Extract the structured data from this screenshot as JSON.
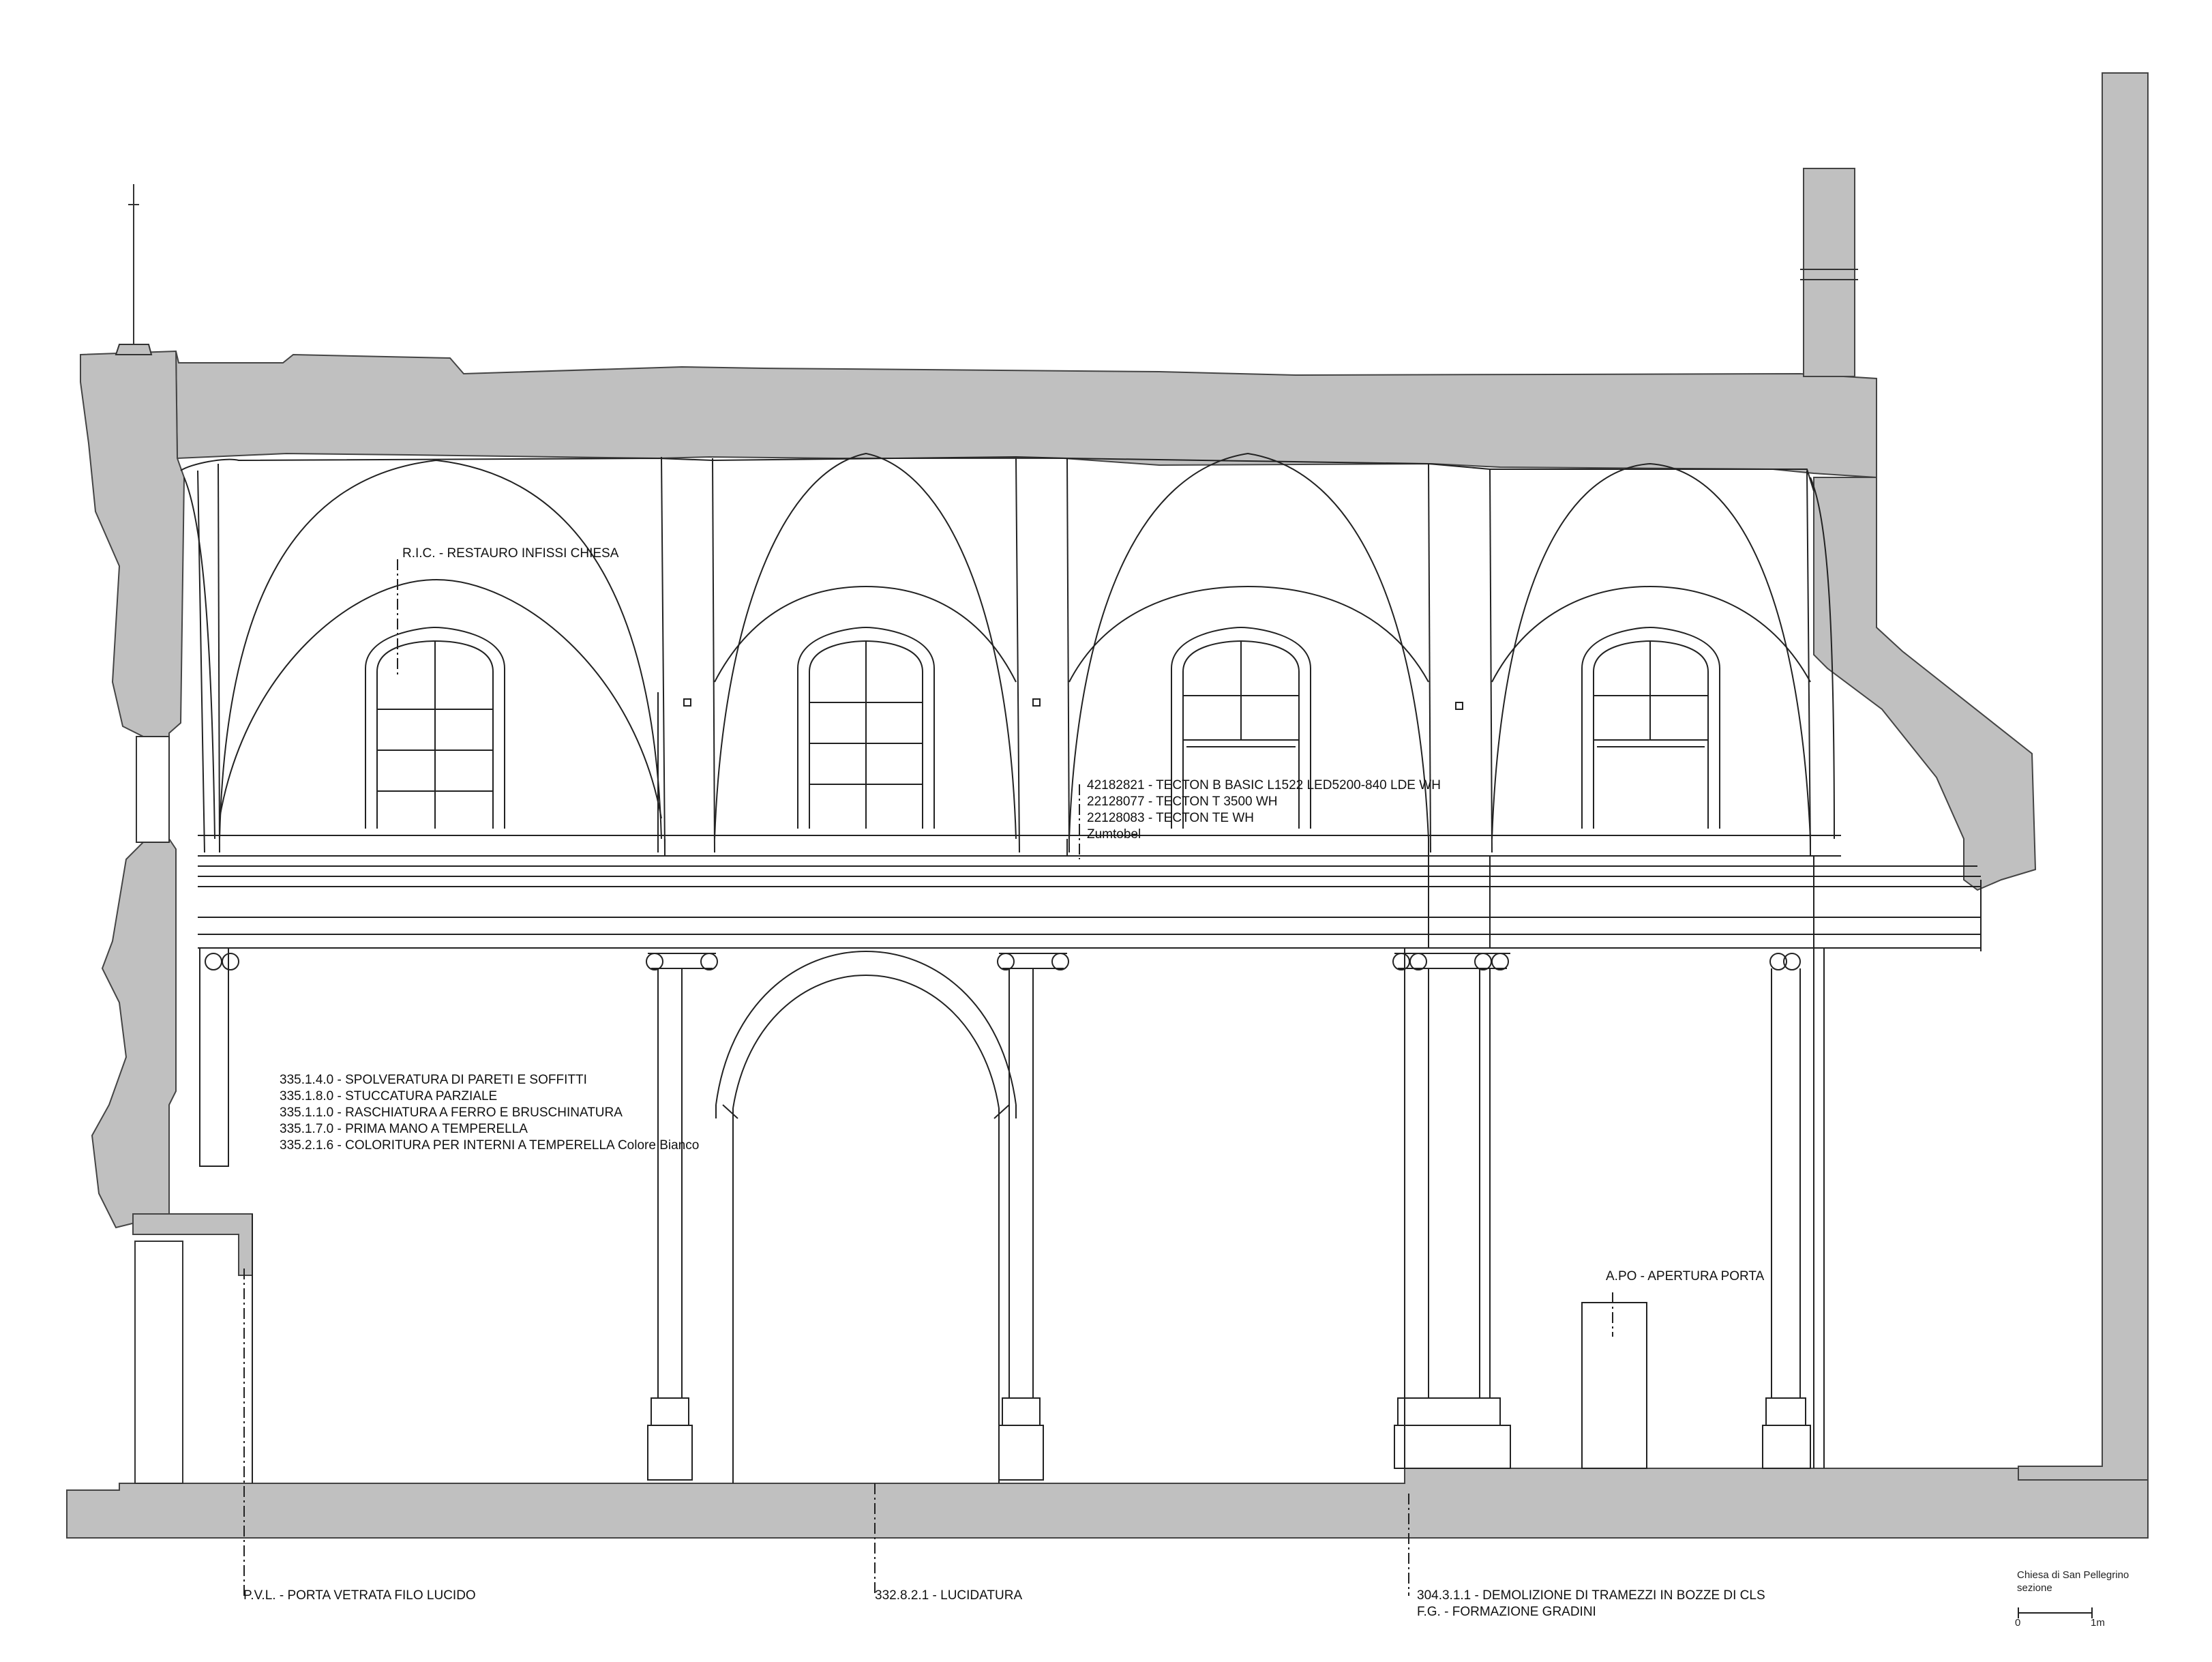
{
  "notes": {
    "ric": "R.I.C. - RESTAURO INFISSI CHIESA",
    "lighting": [
      "42182821 - TECTON B BASIC L1522 LED5200-840 LDE WH",
      "22128077 - TECTON T 3500 WH",
      "22128083 - TECTON TE WH",
      "Zumtobel"
    ],
    "finishes": [
      "335.1.4.0 - SPOLVERATURA DI PARETI E SOFFITTI",
      "335.1.8.0 - STUCCATURA PARZIALE",
      "335.1.1.0 - RASCHIATURA A FERRO E BRUSCHINATURA",
      "335.1.7.0 - PRIMA MANO A TEMPERELLA",
      "335.2.1.6 - COLORITURA PER INTERNI A TEMPERELLA Colore Bianco"
    ],
    "apo": "A.PO - APERTURA PORTA",
    "pvl": "P.V.L. - PORTA VETRATA FILO LUCIDO",
    "lucidatura": "332.8.2.1 - LUCIDATURA",
    "demolizione": [
      "304.3.1.1 - DEMOLIZIONE DI TRAMEZZI IN BOZZE DI CLS",
      "F.G. - FORMAZIONE GRADINI"
    ]
  },
  "title_block": {
    "project": "Chiesa di San Pellegrino",
    "view": "sezione",
    "scale_start": "0",
    "scale_end": "1m"
  },
  "colors": {
    "wall_fill": "#c0c0c0",
    "line": "#222222",
    "glass": "#2a5bd7"
  }
}
